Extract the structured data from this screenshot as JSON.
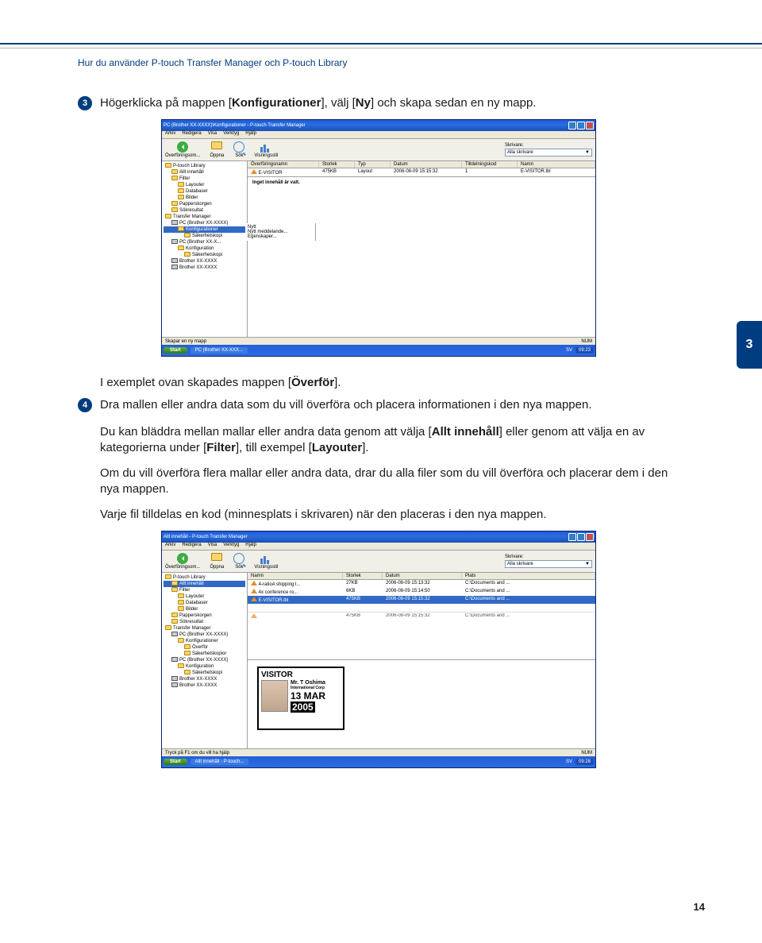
{
  "header": "Hur du använder P-touch Transfer Manager och P-touch Library",
  "sectionBadge": "3",
  "pageNumber": "14",
  "steps": {
    "s3": {
      "num": "3",
      "text_a": "Högerklicka på mappen [",
      "b1": "Konfigurationer",
      "text_b": "], välj [",
      "b2": "Ny",
      "text_c": "] och skapa sedan en ny mapp."
    },
    "p_example": {
      "a": "I exemplet ovan skapades mappen [",
      "b": "Överför",
      "c": "]."
    },
    "s4": {
      "num": "4",
      "text": "Dra mallen eller andra data som du vill överföra och placera informationen i den nya mappen."
    },
    "p_browse": {
      "a": "Du kan bläddra mellan mallar eller andra data genom att välja [",
      "b1": "Allt innehåll",
      "b": "] eller genom att välja en av kategorierna under [",
      "b2": "Filter",
      "c": "], till exempel [",
      "b3": "Layouter",
      "d": "]."
    },
    "p_multi": "Om du vill överföra flera mallar eller andra data, drar du alla filer som du vill överföra och placerar dem i den nya mappen.",
    "p_code": "Varje fil tilldelas en kod (minnesplats i skrivaren) när den placeras i den nya mappen."
  },
  "shot1": {
    "title": "PC (Brother XX-XXXX)\\Konfigurationer - P-touch Transfer Manager",
    "menus": [
      "Arkiv",
      "Redigera",
      "Visa",
      "Verktyg",
      "Hjälp"
    ],
    "tools": {
      "back": "Överföringsom...",
      "open": "Öppna",
      "search": "Sök",
      "display": "Visningsstil"
    },
    "printer_label": "Skrivare:",
    "printer_value": "Alla skrivare",
    "columns": [
      "Överföringsnamn",
      "Storlek",
      "Typ",
      "Datum",
      "Tilldelningskod",
      "Namn"
    ],
    "row": [
      "E-VISITOR",
      "475KB",
      "Layout",
      "2006-08-09 15:15:32",
      "1",
      "E-VISITOR.lbl"
    ],
    "tree": [
      {
        "lvl": 0,
        "t": "P-touch Library"
      },
      {
        "lvl": 1,
        "t": "Allt innehåll"
      },
      {
        "lvl": 1,
        "t": "Filter"
      },
      {
        "lvl": 2,
        "t": "Layouter"
      },
      {
        "lvl": 2,
        "t": "Databaser"
      },
      {
        "lvl": 2,
        "t": "Bilder"
      },
      {
        "lvl": 1,
        "t": "Papperskorgen"
      },
      {
        "lvl": 1,
        "t": "Sökresultat"
      },
      {
        "lvl": 0,
        "t": "Transfer Manager"
      },
      {
        "lvl": 1,
        "t": "PC (Brother XX-XXXX)"
      },
      {
        "lvl": 2,
        "t": "Konfigurationer",
        "sel": true
      },
      {
        "lvl": 3,
        "t": "Säkerhetskopi"
      },
      {
        "lvl": 1,
        "t": "PC (Brother XX-X..."
      },
      {
        "lvl": 2,
        "t": "Konfiguration"
      },
      {
        "lvl": 3,
        "t": "Säkerhetskopi"
      },
      {
        "lvl": 1,
        "t": "Brother XX-XXXX"
      },
      {
        "lvl": 1,
        "t": "Brother XX-XXXX"
      }
    ],
    "ctx": [
      "Nytt",
      "Nytt meddelande...",
      "Egenskaper..."
    ],
    "preview": "Inget innehåll är valt.",
    "status_l": "Skapar en ny mapp",
    "status_r": "NUM",
    "task_start": "Start",
    "task_app": "PC (Brother XX-XXX...",
    "task_lang": "SV",
    "task_time": "09:23"
  },
  "shot2": {
    "title": "Allt innehåll - P-touch Transfer Manager",
    "menus": [
      "Arkiv",
      "Redigera",
      "Visa",
      "Verktyg",
      "Hjälp"
    ],
    "tools": {
      "back": "Överföringsom...",
      "open": "Öppna",
      "search": "Sök",
      "display": "Visningsstil"
    },
    "printer_label": "Skrivare:",
    "printer_value": "Alla skrivare",
    "columns": [
      "Namn",
      "Storlek",
      "Datum",
      "Plats"
    ],
    "rows": [
      [
        "4-ratioA shipping l...",
        "27KB",
        "2006-08-09 15:13:32",
        "C:\\Documents and ..."
      ],
      [
        "4x conference ro...",
        "6KB",
        "2006-08-09 15:14:50",
        "C:\\Documents and ..."
      ],
      [
        "E-VISITOR.lbl",
        "475KB",
        "2006-08-09 15:15:32",
        "C:\\Documents and ..."
      ]
    ],
    "sel_row": 2,
    "below_row": [
      "",
      "475KB",
      "2006-08-09 15:15:32",
      "C:\\Documents and ..."
    ],
    "tree": [
      {
        "lvl": 0,
        "t": "P-touch Library"
      },
      {
        "lvl": 1,
        "t": "Allt innehåll",
        "sel": true
      },
      {
        "lvl": 1,
        "t": "Filter"
      },
      {
        "lvl": 2,
        "t": "Layouter"
      },
      {
        "lvl": 2,
        "t": "Databaser"
      },
      {
        "lvl": 2,
        "t": "Bilder"
      },
      {
        "lvl": 1,
        "t": "Papperskorgen"
      },
      {
        "lvl": 1,
        "t": "Sökresultat"
      },
      {
        "lvl": 0,
        "t": "Transfer Manager"
      },
      {
        "lvl": 1,
        "t": "PC (Brother XX-XXXX)"
      },
      {
        "lvl": 2,
        "t": "Konfigurationer"
      },
      {
        "lvl": 3,
        "t": "Överför"
      },
      {
        "lvl": 3,
        "t": "Säkerhetskopior"
      },
      {
        "lvl": 1,
        "t": "PC (Brother XX-XXXX)"
      },
      {
        "lvl": 2,
        "t": "Konfiguration"
      },
      {
        "lvl": 3,
        "t": "Säkerhetskopi"
      },
      {
        "lvl": 1,
        "t": "Brother XX-XXXX"
      },
      {
        "lvl": 1,
        "t": "Brother XX-XXXX"
      }
    ],
    "card": {
      "title": "VISITOR",
      "name": "Mr. T Oshima",
      "corp": "International Corp",
      "d1": "13 MAR",
      "d2": "2005"
    },
    "status_l": "Tryck på F1 om du vill ha hjälp",
    "status_r": "NUM",
    "task_start": "Start",
    "task_app": "Allt innehåll - P-touch...",
    "task_lang": "SV",
    "task_time": "09:28"
  }
}
